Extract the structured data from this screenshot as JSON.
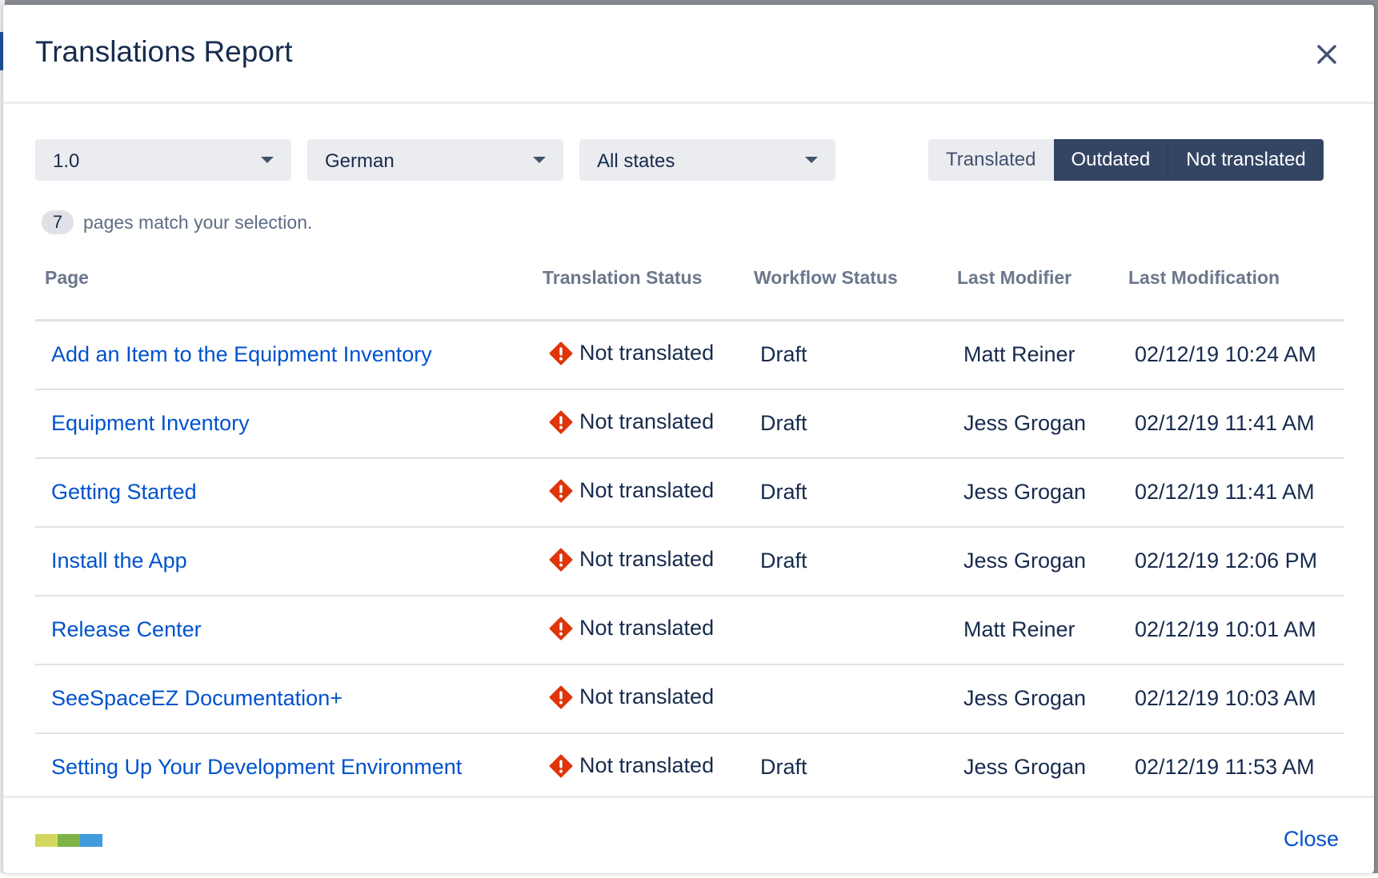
{
  "dialog": {
    "title": "Translations Report",
    "close_link": "Close"
  },
  "filters": {
    "version": "1.0",
    "language": "German",
    "state": "All states"
  },
  "toggles": [
    {
      "label": "Translated",
      "active": false
    },
    {
      "label": "Outdated",
      "active": true
    },
    {
      "label": "Not translated",
      "active": true
    }
  ],
  "match": {
    "count": "7",
    "text": "pages match your selection."
  },
  "table": {
    "headers": {
      "page": "Page",
      "translation_status": "Translation Status",
      "workflow_status": "Workflow Status",
      "last_modifier": "Last Modifier",
      "last_modification": "Last Modification"
    },
    "rows": [
      {
        "page": "Add an Item to the Equipment Inventory",
        "status": "Not translated",
        "workflow": "Draft",
        "modifier": "Matt Reiner",
        "modified": "02/12/19 10:24 AM"
      },
      {
        "page": "Equipment Inventory",
        "status": "Not translated",
        "workflow": "Draft",
        "modifier": "Jess Grogan",
        "modified": "02/12/19 11:41 AM"
      },
      {
        "page": "Getting Started",
        "status": "Not translated",
        "workflow": "Draft",
        "modifier": "Jess Grogan",
        "modified": "02/12/19 11:41 AM"
      },
      {
        "page": "Install the App",
        "status": "Not translated",
        "workflow": "Draft",
        "modifier": "Jess Grogan",
        "modified": "02/12/19 12:06 PM"
      },
      {
        "page": "Release Center",
        "status": "Not translated",
        "workflow": "",
        "modifier": "Matt Reiner",
        "modified": "02/12/19 10:01 AM"
      },
      {
        "page": "SeeSpaceEZ Documentation+",
        "status": "Not translated",
        "workflow": "",
        "modifier": "Jess Grogan",
        "modified": "02/12/19 10:03 AM"
      },
      {
        "page": "Setting Up Your Development Environment",
        "status": "Not translated",
        "workflow": "Draft",
        "modifier": "Jess Grogan",
        "modified": "02/12/19 11:53 AM"
      }
    ]
  },
  "icons": {
    "close": "close-icon",
    "status": "error-diamond-icon",
    "dropdown": "chevron-down-icon",
    "logo": "logo-icon"
  },
  "colors": {
    "link": "#0052cc",
    "toggle_active": "#344563",
    "status_error": "#de350b",
    "logo": [
      "#d4d75f",
      "#7db347",
      "#3f9bdc"
    ]
  }
}
